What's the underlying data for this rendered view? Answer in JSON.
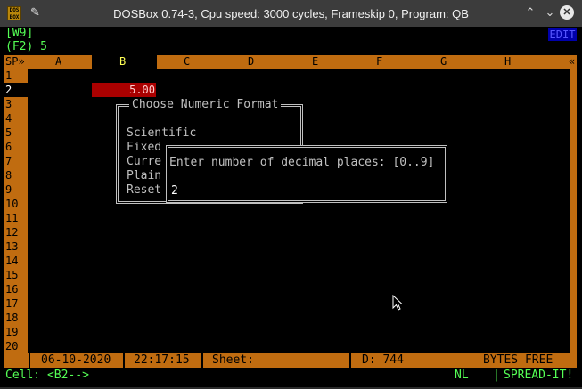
{
  "window": {
    "app_icon_text": "DOS\nBOX",
    "title": "DOSBox 0.74-3, Cpu speed: 3000 cycles, Frameskip 0, Program: QB"
  },
  "header": {
    "cell_ref": "[W9]",
    "cell_content": "(F2) 5",
    "mode": "EDIT"
  },
  "grid": {
    "corner": "SP»",
    "scroll_marker": "«",
    "columns": [
      "A",
      "B",
      "C",
      "D",
      "E",
      "F",
      "G",
      "H"
    ],
    "rows": [
      "1",
      "2",
      "3",
      "4",
      "5",
      "6",
      "7",
      "8",
      "9",
      "10",
      "11",
      "12",
      "13",
      "14",
      "15",
      "16",
      "17",
      "18",
      "19",
      "20"
    ],
    "active_column": "B",
    "active_row": "2",
    "cell_b2_value": "5.00"
  },
  "format_menu": {
    "title": "Choose Numeric Format",
    "options": [
      "Scientific",
      "Fixed",
      "Curre",
      "Plain",
      "Reset"
    ]
  },
  "decimal_dialog": {
    "prompt": "Enter number of decimal places: [0..9]",
    "value": "2"
  },
  "status": {
    "date": "06-10-2020",
    "time": "22:17:15",
    "sheet_label": "Sheet:",
    "disk": "D: 744",
    "bytes_free": "BYTES FREE",
    "cell_indicator": "Cell: <B2-->",
    "numlock": "NL",
    "brand": "SPREAD-IT!"
  },
  "colors": {
    "header_orange": "#c06c10",
    "cell_highlight": "#aa0000",
    "text_green": "#55ff55"
  }
}
